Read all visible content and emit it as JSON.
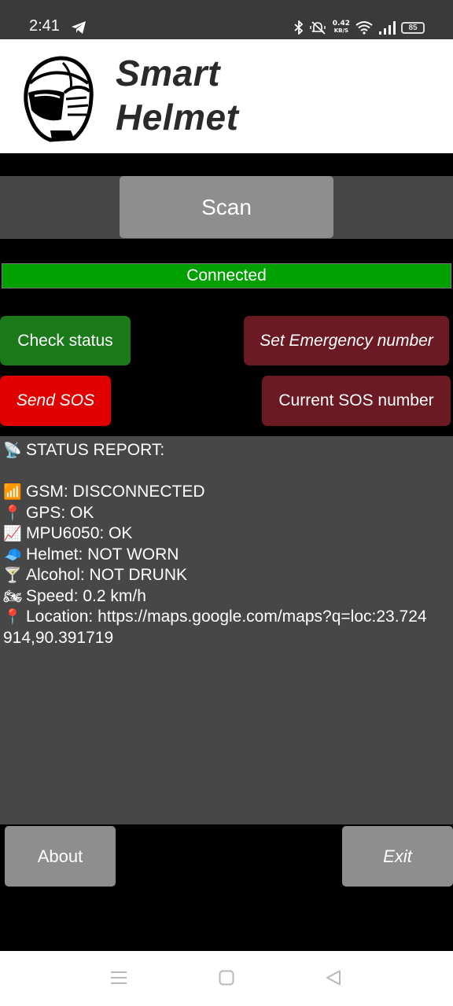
{
  "status_bar": {
    "time": "2:41",
    "net_speed_value": "0.42",
    "net_speed_unit": "KB/S",
    "battery": "85",
    "icons": [
      "telegram-icon",
      "bluetooth-icon",
      "mute-icon",
      "wifi-icon",
      "signal-icon",
      "battery-icon"
    ]
  },
  "header": {
    "logo_icon": "helmet-icon",
    "title": "Smart\nHelmet"
  },
  "scan_label": "Scan",
  "connection_status": "Connected",
  "buttons": {
    "check_status": "Check status",
    "set_emergency": "Set Emergency number",
    "send_sos": "Send SOS",
    "current_sos": "Current SOS number",
    "about": "About",
    "exit": "Exit"
  },
  "report": {
    "title_emoji": "📡",
    "title": "STATUS REPORT:",
    "lines": [
      {
        "emoji": "📶",
        "text": "GSM: DISCONNECTED"
      },
      {
        "emoji": "📍",
        "text": "GPS: OK"
      },
      {
        "emoji": "📈",
        "text": "MPU6050: OK"
      },
      {
        "emoji": "🧢",
        "text": "Helmet: NOT WORN"
      },
      {
        "emoji": "🍸",
        "text": "Alcohol: NOT DRUNK"
      },
      {
        "emoji": "🏍",
        "text": "Speed: 0.2 km/h"
      },
      {
        "emoji": "📍",
        "text": "Location: https://maps.google.com/maps?q=loc:23.724914,90.391719"
      }
    ]
  },
  "colors": {
    "connected": "#00a000",
    "check_status": "#1a7a1a",
    "emergency": "#6b1a24",
    "sos": "#e10000",
    "panel": "#474747",
    "button_gray": "#8e8e8e"
  },
  "nav_bar": {
    "icons": [
      "menu-icon",
      "home-icon",
      "back-icon"
    ]
  }
}
